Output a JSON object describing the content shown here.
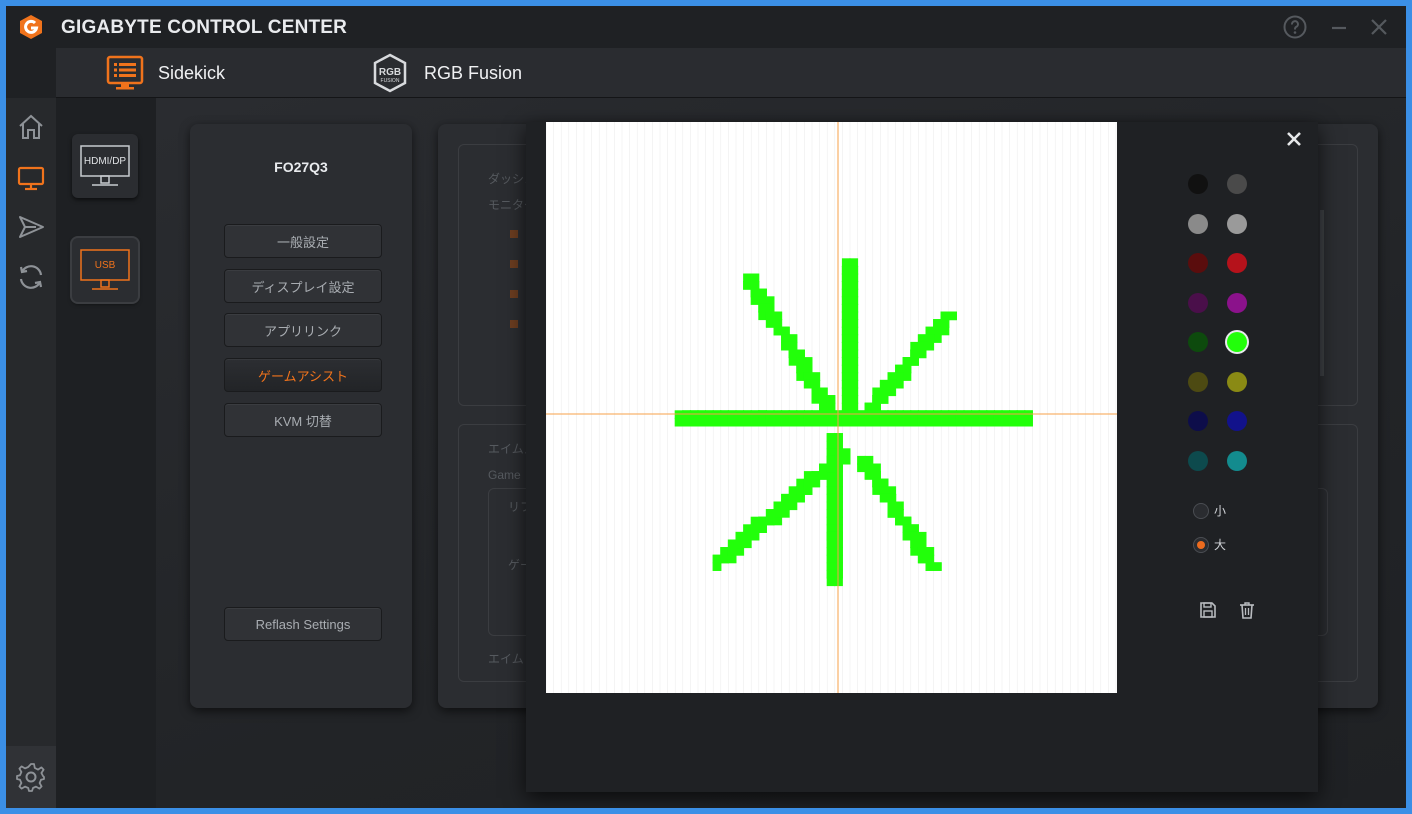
{
  "app": {
    "title": "GIGABYTE CONTROL CENTER",
    "accent": "#f0731c"
  },
  "titlebar": {
    "help_icon": "help-circle-icon",
    "minimize_icon": "minimize-icon",
    "close_icon": "close-icon"
  },
  "topnav": {
    "tabs": [
      {
        "label": "Sidekick",
        "icon": "sidekick-monitor-icon",
        "active": true
      },
      {
        "label": "RGB Fusion",
        "icon": "rgb-fusion-icon",
        "active": false
      }
    ],
    "rgb_badge_text": "RGB",
    "rgb_badge_sub": "FUSION"
  },
  "sidebar": {
    "items": [
      {
        "icon": "home-icon"
      },
      {
        "icon": "monitor-icon",
        "active": true
      },
      {
        "icon": "send-icon"
      },
      {
        "icon": "refresh-icon"
      }
    ],
    "settings_icon": "gear-icon"
  },
  "devices": [
    {
      "label": "HDMI/DP",
      "active": false
    },
    {
      "label": "USB",
      "active": true
    }
  ],
  "model_panel": {
    "model": "FO27Q3",
    "menu": [
      {
        "label": "一般設定",
        "active": false
      },
      {
        "label": "ディスプレイ設定",
        "active": false
      },
      {
        "label": "アプリリンク",
        "active": false
      },
      {
        "label": "ゲームアシスト",
        "active": true
      },
      {
        "label": "KVM 切替",
        "active": false
      }
    ],
    "reflash_label": "Reflash Settings"
  },
  "background_panel": {
    "text1": "ダッシュ",
    "text2": "モニター",
    "text3": "エイムス",
    "text4": "Game",
    "text5": "リフ",
    "text6": "ゲー",
    "text7": "エイム"
  },
  "crosshair_editor": {
    "close_icon": "close-icon",
    "palette": [
      [
        "#111111",
        "#4a4a4a"
      ],
      [
        "#8a8a8a",
        "#9a9a9a"
      ],
      [
        "#5a0d0d",
        "#b5121b"
      ],
      [
        "#4a0f4a",
        "#8b128b"
      ],
      [
        "#0d4a0d",
        "#22ff0a"
      ],
      [
        "#4d4a12",
        "#8a8a14"
      ],
      [
        "#0d0d4a",
        "#12128b"
      ],
      [
        "#0d4a4d",
        "#138b8e"
      ]
    ],
    "selected_color": "#22ff0a",
    "sizes": [
      {
        "label": "小",
        "selected": false
      },
      {
        "label": "大",
        "selected": true
      }
    ],
    "save_icon": "save-icon",
    "delete_icon": "trash-icon",
    "guide_color": "#f7a14a"
  }
}
